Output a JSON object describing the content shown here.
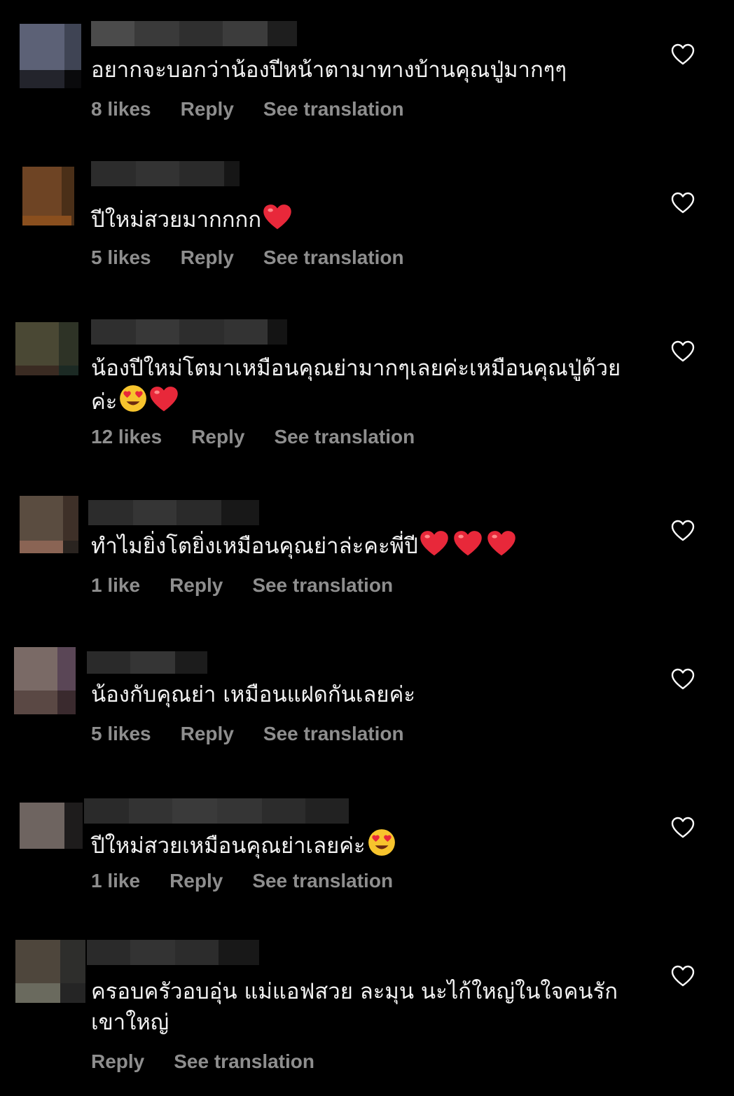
{
  "comments": [
    {
      "text": "อยากจะบอกว่าน้องปีหน้าตามาทางบ้านคุณปู่มากๆๆ",
      "emoji": [],
      "likes": "8 likes",
      "reply": "Reply",
      "translate": "See translation"
    },
    {
      "text": "ปีใหม่สวยมากกกก",
      "emoji": [
        "heart"
      ],
      "likes": "5 likes",
      "reply": "Reply",
      "translate": "See translation"
    },
    {
      "text": "น้องปีใหม่โตมาเหมือนคุณย่ามากๆเลยค่ะเหมือนคุณปู่ด้วยค่ะ",
      "emoji": [
        "heart-eyes",
        "heart"
      ],
      "likes": "12 likes",
      "reply": "Reply",
      "translate": "See translation"
    },
    {
      "text": "ทำไมยิ่งโตยิ่งเหมือนคุณย่าล่ะคะพี่ปี",
      "emoji": [
        "heart",
        "heart",
        "heart"
      ],
      "likes": "1 like",
      "reply": "Reply",
      "translate": "See translation"
    },
    {
      "text": "น้องกับคุณย่า เหมือนแฝดกันเลยค่ะ",
      "emoji": [],
      "likes": "5 likes",
      "reply": "Reply",
      "translate": "See translation"
    },
    {
      "text": "ปีใหม่สวยเหมือนคุณย่าเลยค่ะ",
      "emoji": [
        "heart-eyes"
      ],
      "likes": "1 like",
      "reply": "Reply",
      "translate": "See translation"
    },
    {
      "text": "ครอบครัวอบอุ่น แม่แอฟสวย ละมุน นะไก้ใหญ่ในใจคนรักเขาใหญ่",
      "emoji": [],
      "likes": "",
      "reply": "Reply",
      "translate": "See translation"
    }
  ],
  "icons": {
    "like": "heart-outline-icon"
  },
  "colors": {
    "background": "#000000",
    "text": "#f2f2f2",
    "meta": "#8e8e8e",
    "heart": "#e8283a"
  }
}
